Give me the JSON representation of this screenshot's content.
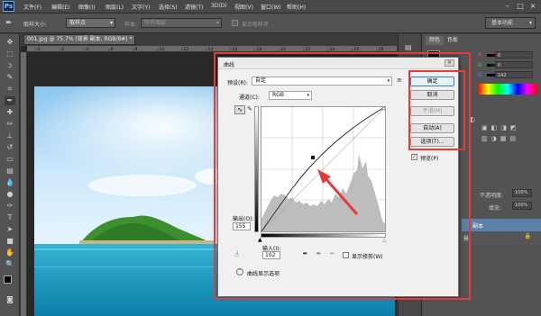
{
  "app": {
    "logo": "Ps",
    "menu": [
      "文件(F)",
      "编辑(E)",
      "图像(I)",
      "图层(L)",
      "文字(Y)",
      "选择(S)",
      "滤镜(T)",
      "3D(D)",
      "视图(V)",
      "窗口(W)",
      "帮助(H)"
    ]
  },
  "options_bar": {
    "tool_icon": "eyedropper-icon",
    "sample_size_label": "取样大小:",
    "sample_size_value": "取样点",
    "sample_label": "样本:",
    "sample_value": "所有图层",
    "show_ring_label": "显示取样环",
    "workspace": "基本功能"
  },
  "document": {
    "tab_title": "001.jpg @ 75.7% (背景 副本, RGB/8#) *",
    "ruler_ticks": [
      "0",
      "2",
      "4",
      "6",
      "8",
      "10",
      "12",
      "14",
      "16",
      "18",
      "20",
      "22",
      "24",
      "26",
      "28"
    ]
  },
  "right_panel": {
    "tab_color": "颜色",
    "tab_swatches": "色板",
    "r_value": "0",
    "g_value": "0",
    "b_value": "142",
    "opacity_label": "不透明度:",
    "opacity_value": "100%",
    "fill_label": "填充:",
    "fill_value": "100%",
    "layer_active": "副本",
    "layer_bg_label": "景"
  },
  "curves_dialog": {
    "title": "曲线",
    "close": "×",
    "preset_label": "预设(R):",
    "preset_value": "自定",
    "channel_label": "通道(C):",
    "channel_value": "RGB",
    "output_label": "输出(O):",
    "output_value": "155",
    "input_label": "输入(I):",
    "input_value": "102",
    "show_clipping_label": "显示修剪(W)",
    "curve_display_options": "曲线显示选项",
    "buttons": {
      "ok": "确定",
      "cancel": "取消",
      "smooth": "平滑(M)",
      "auto": "自动(A)",
      "options": "选项(T)..."
    },
    "preview_label": "预览(P)",
    "preview_checked": true
  },
  "colors": {
    "highlight": "#e23c3c",
    "arrow": "#e23c3c",
    "accent_blue": "#3c7fb1"
  }
}
